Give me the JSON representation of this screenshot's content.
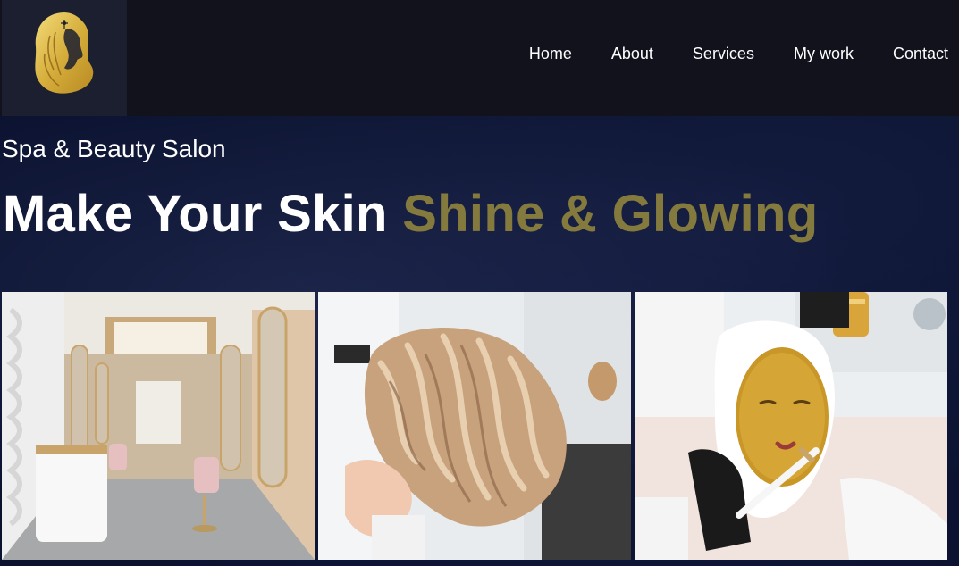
{
  "nav": {
    "logo": "salon-logo",
    "links": [
      "Home",
      "About",
      "Services",
      "My work",
      "Contact"
    ]
  },
  "hero": {
    "subtitle": "Spa & Beauty Salon",
    "headline_main": "Make Your Skin ",
    "headline_accent": "Shine & Glowing",
    "accent_color": "#847a3d"
  },
  "gallery": {
    "images": [
      "salon-interior-photo",
      "wavy-blonde-hair-photo",
      "gold-face-mask-treatment-photo"
    ]
  }
}
